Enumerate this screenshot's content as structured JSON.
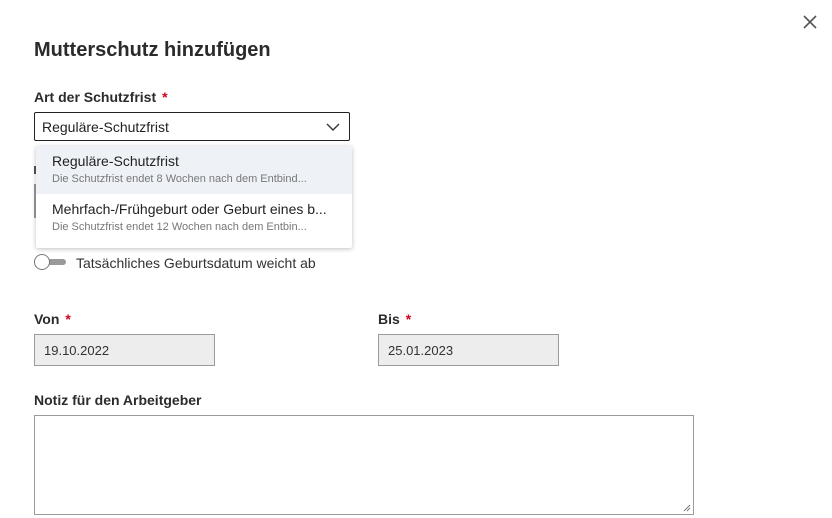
{
  "dialog": {
    "title": "Mutterschutz hinzufügen",
    "close_icon": "close-icon"
  },
  "schutzfrist": {
    "label": "Art der Schutzfrist",
    "required_mark": "*",
    "selected": "Reguläre-Schutzfrist",
    "options": [
      {
        "title": "Reguläre-Schutzfrist",
        "description": "Die Schutzfrist endet 8 Wochen nach dem Entbind..."
      },
      {
        "title": "Mehrfach-/Frühgeburt oder Geburt eines b...",
        "description": "Die Schutzfrist endet 12 Wochen nach dem Entbin..."
      }
    ]
  },
  "toggle": {
    "label": "Tatsächliches Geburtsdatum weicht ab",
    "on": false
  },
  "von": {
    "label": "Von",
    "required_mark": "*",
    "value": "19.10.2022"
  },
  "bis": {
    "label": "Bis",
    "required_mark": "*",
    "value": "25.01.2023"
  },
  "notiz": {
    "label": "Notiz für den Arbeitgeber",
    "value": ""
  },
  "colors": {
    "required": "#d0021b",
    "disabled_bg": "#ededed",
    "option_highlight": "#eef2f7"
  }
}
